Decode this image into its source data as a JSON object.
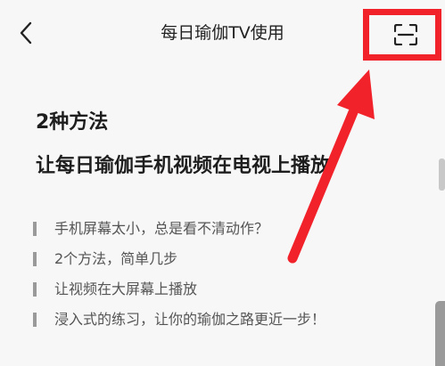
{
  "header": {
    "title": "每日瑜伽TV使用"
  },
  "main": {
    "headline_line1": "2种方法",
    "headline_line2": "让每日瑜伽手机视频在电视上播放",
    "bullets": [
      "手机屏幕太小，总是看不清动作？",
      "2个方法，简单几步",
      "让视频在大屏幕上播放",
      "浸入式的练习，让你的瑜伽之路更近一步！"
    ]
  },
  "annotation": {
    "highlight_color": "#f2222a"
  },
  "icons": {
    "back": "chevron-left-icon",
    "scan": "scan-icon"
  }
}
